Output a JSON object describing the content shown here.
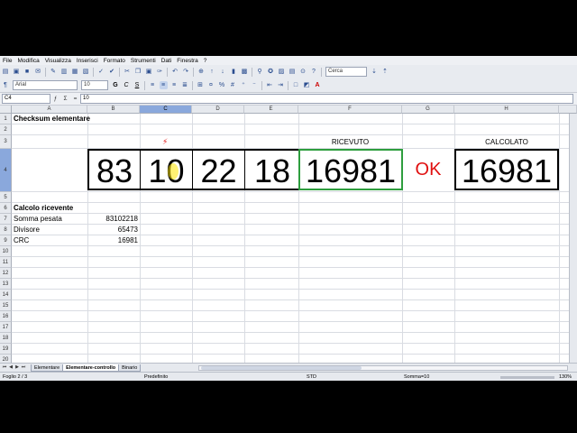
{
  "menu": [
    "File",
    "Modifica",
    "Visualizza",
    "Inserisci",
    "Formato",
    "Strumenti",
    "Dati",
    "Finestra",
    "?"
  ],
  "toolbar": {
    "search_placeholder": "Cerca"
  },
  "format": {
    "font_name": "Arial",
    "font_size": "10",
    "bold": "G",
    "italic": "C",
    "underline": "S"
  },
  "formula": {
    "cell_ref": "C4",
    "content": "10",
    "fx": "ƒ",
    "sum": "Σ",
    "eq": "="
  },
  "columns": [
    "A",
    "B",
    "C",
    "D",
    "E",
    "F",
    "G",
    "H"
  ],
  "rows": [
    "1",
    "2",
    "3",
    "4",
    "5",
    "6",
    "7",
    "8",
    "9",
    "10",
    "11",
    "12",
    "13",
    "14",
    "15",
    "16",
    "17",
    "18",
    "19",
    "20"
  ],
  "cells": {
    "title": "Checksum elementare",
    "marker": "⚡",
    "ricevuto_label": "RICEVUTO",
    "calcolato_label": "CALCOLATO",
    "b1": "83",
    "b2": "10",
    "b3": "22",
    "b4": "18",
    "received": "16981",
    "status": "OK",
    "computed": "16981",
    "section": "Calcolo ricevente",
    "somma_label": "Somma pesata",
    "somma_value": "83102218",
    "divisore_label": "Divisore",
    "divisore_value": "65473",
    "crc_label": "CRC",
    "crc_value": "16981"
  },
  "sheet_tabs": [
    "Elementare",
    "Elementare-controllo",
    "Binario"
  ],
  "status": {
    "sheet": "Foglio 2 / 3",
    "style": "Predefinito",
    "mode": "STD",
    "sum": "Somma=10",
    "zoom": "130%"
  },
  "colors": {
    "accent": "#8aa8dc",
    "ok": "#e01010",
    "received_border": "#2e9e3e"
  }
}
